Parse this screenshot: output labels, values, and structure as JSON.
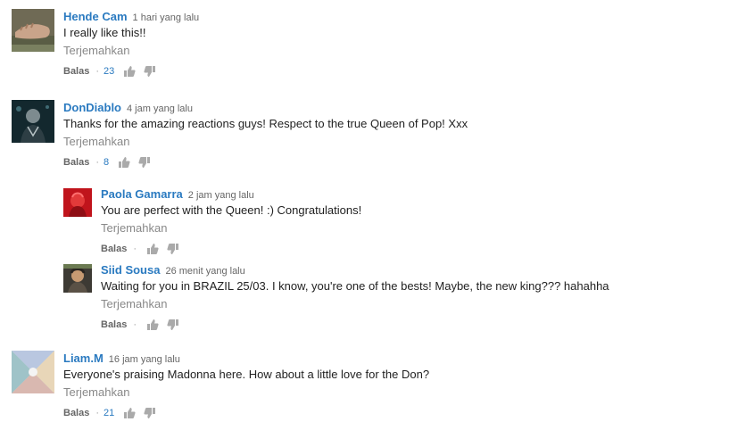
{
  "comments": [
    {
      "author": "Hende Cam",
      "time": "1 hari yang lalu",
      "text": "I really like this!!",
      "translate": "Terjemahkan",
      "reply": "Balas",
      "likes": "23"
    },
    {
      "author": "DonDiablo",
      "time": "4 jam yang lalu",
      "text": "Thanks for the amazing reactions guys! Respect to the true Queen of Pop! Xxx",
      "translate": "Terjemahkan",
      "reply": "Balas",
      "likes": "8"
    },
    {
      "author": "Paola Gamarra",
      "time": "2 jam yang lalu",
      "text": "You are perfect with the Queen! :) Congratulations!",
      "translate": "Terjemahkan",
      "reply": "Balas",
      "likes": ""
    },
    {
      "author": "Siid Sousa",
      "time": "26 menit yang lalu",
      "text": "Waiting for you in BRAZIL 25/03. I know, you're one of the bests! Maybe, the new king??? hahahha",
      "translate": "Terjemahkan",
      "reply": "Balas",
      "likes": ""
    },
    {
      "author": "Liam.M",
      "time": "16 jam yang lalu",
      "text": "Everyone's praising Madonna here. How about a little love for the Don?",
      "translate": "Terjemahkan",
      "reply": "Balas",
      "likes": "21"
    }
  ],
  "icons": {
    "like": "thumb-up-icon",
    "dislike": "thumb-down-icon"
  },
  "colors": {
    "author": "#2a7ac0",
    "likes": "#2a7ac0",
    "muted": "#888888"
  }
}
